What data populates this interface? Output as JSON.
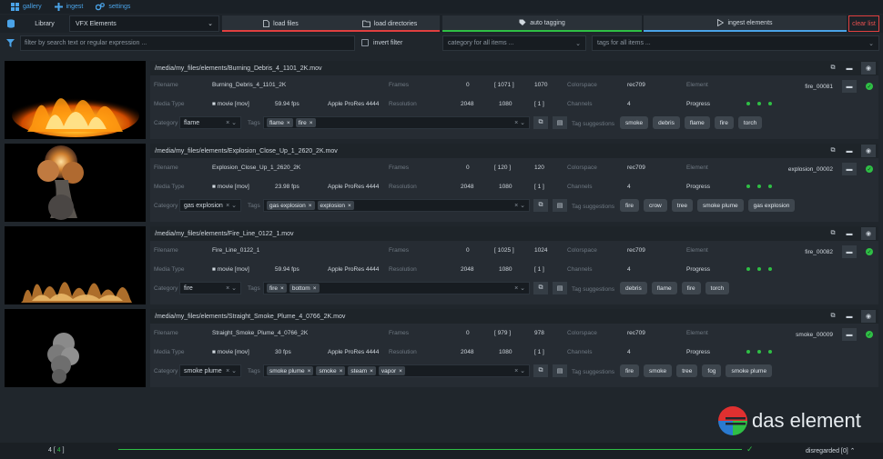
{
  "nav": [
    {
      "label": "gallery",
      "icon": "grid-icon"
    },
    {
      "label": "ingest",
      "icon": "plus-icon"
    },
    {
      "label": "settings",
      "icon": "gears-icon"
    }
  ],
  "toolbar": {
    "library_label": "Library",
    "library_value": "VFX Elements",
    "load_files": "load files",
    "load_directories": "load directories",
    "auto_tagging": "auto tagging",
    "ingest_elements": "ingest elements",
    "clear_list": "clear list"
  },
  "filter": {
    "placeholder": "filter by search text or regular expression ...",
    "invert": "invert filter",
    "category": "category for all items ...",
    "tags": "tags for all items ..."
  },
  "labels": {
    "filename": "Filename",
    "media_type": "Media Type",
    "frames": "Frames",
    "resolution": "Resolution",
    "colorspace": "Colorspace",
    "channels": "Channels",
    "element": "Element",
    "progress": "Progress",
    "category": "Category",
    "tags": "Tags",
    "tag_suggestions": "Tag suggestions"
  },
  "items": [
    {
      "path": "/media/my_files/elements/Burning_Debris_4_1101_2K.mov",
      "filename": "Burning_Debris_4_1101_2K",
      "media": "movie [mov]",
      "fps": "59.94 fps",
      "codec": "Apple ProRes 4444",
      "frame_start": "0",
      "frame_count": "[ 1071 ]",
      "frame_end": "1070",
      "res_w": "2048",
      "res_h": "1080",
      "res_ratio": "[ 1 ]",
      "colorspace": "rec709",
      "channels": "4",
      "element": "fire_00081",
      "category": "flame",
      "tags": [
        "flame",
        "fire"
      ],
      "suggestions": [
        "smoke",
        "debris",
        "flame",
        "fire",
        "torch"
      ]
    },
    {
      "path": "/media/my_files/elements/Explosion_Close_Up_1_2620_2K.mov",
      "filename": "Explosion_Close_Up_1_2620_2K",
      "media": "movie [mov]",
      "fps": "23.98 fps",
      "codec": "Apple ProRes 4444",
      "frame_start": "0",
      "frame_count": "[ 120 ]",
      "frame_end": "120",
      "res_w": "2048",
      "res_h": "1080",
      "res_ratio": "[ 1 ]",
      "colorspace": "rec709",
      "channels": "4",
      "element": "explosion_00002",
      "category": "gas explosion",
      "tags": [
        "gas explosion",
        "explosion"
      ],
      "suggestions": [
        "fire",
        "crow",
        "tree",
        "smoke plume",
        "gas explosion"
      ]
    },
    {
      "path": "/media/my_files/elements/Fire_Line_0122_1.mov",
      "filename": "Fire_Line_0122_1",
      "media": "movie [mov]",
      "fps": "59.94 fps",
      "codec": "Apple ProRes 4444",
      "frame_start": "0",
      "frame_count": "[ 1025 ]",
      "frame_end": "1024",
      "res_w": "2048",
      "res_h": "1080",
      "res_ratio": "[ 1 ]",
      "colorspace": "rec709",
      "channels": "4",
      "element": "fire_00082",
      "category": "fire",
      "tags": [
        "fire",
        "bottom"
      ],
      "suggestions": [
        "debris",
        "flame",
        "fire",
        "torch"
      ]
    },
    {
      "path": "/media/my_files/elements/Straight_Smoke_Plume_4_0766_2K.mov",
      "filename": "Straight_Smoke_Plume_4_0766_2K",
      "media": "movie [mov]",
      "fps": "30 fps",
      "codec": "Apple ProRes 4444",
      "frame_start": "0",
      "frame_count": "[ 979 ]",
      "frame_end": "978",
      "res_w": "2048",
      "res_h": "1080",
      "res_ratio": "[ 1 ]",
      "colorspace": "rec709",
      "channels": "4",
      "element": "smoke_00009",
      "category": "smoke plume",
      "tags": [
        "smoke plume",
        "smoke",
        "steam",
        "vapor"
      ],
      "suggestions": [
        "fire",
        "smoke",
        "tree",
        "fog",
        "smoke plume"
      ]
    }
  ],
  "logo": {
    "text": "das element"
  },
  "status": {
    "count": "4",
    "count_bracket": "4",
    "disregarded": "disregarded [0]"
  },
  "colors": {
    "accent": "#4aa3e8",
    "success": "#2fbf45",
    "danger": "#e04040",
    "tab_load": "#e04040",
    "tab_tagging": "#2fbf45",
    "tab_ingest": "#4aa3e8"
  }
}
